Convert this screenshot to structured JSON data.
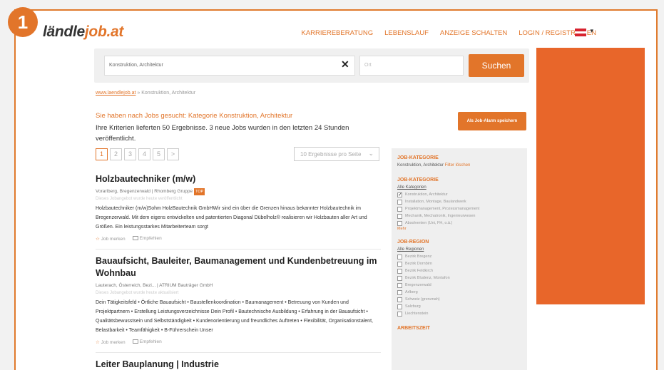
{
  "step_number": "1",
  "logo": {
    "prefix": "ländle",
    "suffix": "job.at"
  },
  "topnav": [
    "KARRIEREBERATUNG",
    "LEBENSLAUF",
    "ANZEIGE SCHALTEN",
    "LOGIN / REGISTRIEREN"
  ],
  "search": {
    "keyword_value": "Konstruktion, Architektur",
    "location_placeholder": "Ort",
    "button_label": "Suchen"
  },
  "breadcrumb": {
    "home": "www.laendlejob.at",
    "separator": "»",
    "current": "Konstruktion, Architektur"
  },
  "results": {
    "heading": "Sie haben nach Jobs gesucht: Kategorie Konstruktion, Architektur",
    "info": "Ihre Kriterien lieferten 50 Ergebnisse. 3 neue Jobs wurden in den letzten 24 Stunden veröffentlicht.",
    "job_alarm_label": "Als Job-Alarm speichern"
  },
  "pagination": {
    "pages": [
      "1",
      "2",
      "3",
      "4",
      "5",
      ">"
    ],
    "active": "1"
  },
  "per_page": {
    "value": "10 Ergebnisse pro Seite"
  },
  "jobs": [
    {
      "title": "Holzbautechniker (m/w)",
      "company": "Vorarlberg, Bregenzerwald | Rhomberg Gruppe",
      "badge": "TOP",
      "meta": "Dieses Jobangebot wurde heute veröffentlicht",
      "description": "Holzbautechniker (m/w)Sohm HolzBautechnik GmbHWir sind ein über die Grenzen hinaus bekannter Holzbautechnik im Bregenzerwald. Mit dem eigens entwickelten und patentierten Diagonal Dübelholz® realisieren wir Holzbauten aller Art und Größen. Ein leistungsstarkes Mitarbeiterteam sorgt",
      "save_label": "Job merken",
      "recommend_label": "Empfehlen"
    },
    {
      "title": "Bauaufsicht, Bauleiter, Baumanagement und Kundenbetreuung im Wohnbau",
      "company": "Lauterach, Österreich, Bezi... | ATRIUM Bauträger GmbH",
      "badge": "",
      "meta": "Dieses Jobangebot wurde heute aktualisiert",
      "description": "Dein Tätigkeitsfeld • Örtliche Bauaufsicht • Baustellenkoordination • Baumanagement • Betreuung von Kunden und Projektpartnern • Erstellung Leistungsverzeichnisse Dein Profil • Bautechnische Ausbildung • Erfahrung in der Bauaufsicht • Qualitätsbewusstsein und Selbstständigkeit • Kundenorientierung und freundliches Auftreten • Flexibilität, Organisationstalent, Belastbarkeit • Teamfähigkeit • B-Führerschein Unser",
      "save_label": "Job merken",
      "recommend_label": "Empfehlen"
    },
    {
      "title": "Leiter Bauplanung | Industrie",
      "company": "",
      "badge": "",
      "meta": "",
      "description": "",
      "save_label": "",
      "recommend_label": ""
    }
  ],
  "sidebar": {
    "selected": {
      "heading": "JOB-KATEGORIE",
      "value": "Konstruktion, Architektur",
      "remove_label": "Filter löschen"
    },
    "category": {
      "heading": "JOB-KATEGORIE",
      "all_label": "Alle Kategorien",
      "options": [
        {
          "label": "Konstruktion, Architektur",
          "checked": true
        },
        {
          "label": "Installation, Montage, Baulandwerk",
          "checked": false
        },
        {
          "label": "Projektmanagement, Prozessmanagement",
          "checked": false
        },
        {
          "label": "Mechanik, Mechatronik, Ingenieurwesen",
          "checked": false
        },
        {
          "label": "Absolventen (Uni, FH, o.ä.)",
          "checked": false
        }
      ],
      "more_label": "Mehr"
    },
    "region": {
      "heading": "JOB-REGION",
      "all_label": "Alle Regionen",
      "options": [
        {
          "label": "Bezirk Bregenz",
          "checked": false
        },
        {
          "label": "Bezirk Dornbirn",
          "checked": false
        },
        {
          "label": "Bezirk Feldkirch",
          "checked": false
        },
        {
          "label": "Bezirk Bludenz, Montafon",
          "checked": false
        },
        {
          "label": "Bregenzerwald",
          "checked": false
        },
        {
          "label": "Arlberg",
          "checked": false
        },
        {
          "label": "Schweiz (grenznah)",
          "checked": false
        },
        {
          "label": "Salzburg",
          "checked": false
        },
        {
          "label": "Liechtenstein",
          "checked": false
        }
      ]
    },
    "worktime": {
      "heading": "ARBEITSZEIT"
    }
  },
  "colors": {
    "accent": "#e2752a",
    "ad": "#e8662a",
    "flag_red": "#d7232f"
  }
}
